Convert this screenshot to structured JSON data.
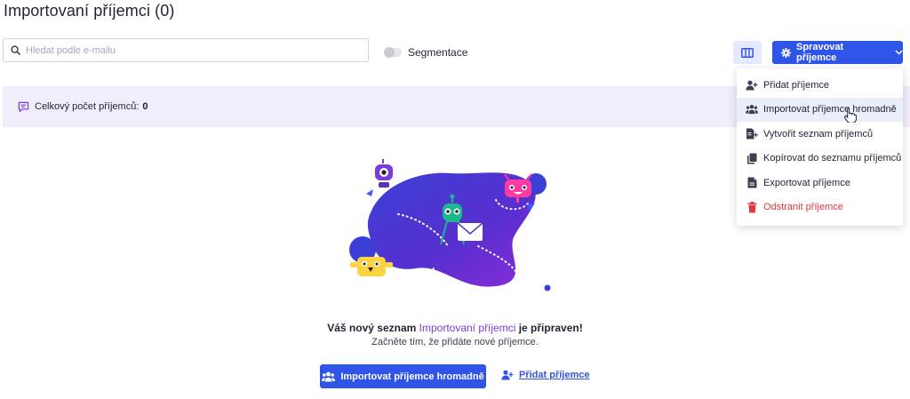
{
  "page": {
    "title": "Importovaní příjemci (0)"
  },
  "toolbar": {
    "search_placeholder": "Hledat podle e-mailu",
    "search_value": "",
    "search_icon": "search-icon",
    "segmentation_label": "Segmentace",
    "segmentation_on": false,
    "columns_icon": "columns-icon",
    "manage_label": "Spravovat příjemce",
    "manage_icon": "gear-icon",
    "manage_chevron": "chevron-down-icon"
  },
  "info": {
    "label": "Celkový počet příjemců:",
    "count": "0",
    "icon": "message-icon"
  },
  "dropdown": {
    "items": [
      {
        "label": "Přidat příjemce",
        "icon": "add-user-icon"
      },
      {
        "label": "Importovat příjemce hromadně",
        "icon": "users-icon",
        "hovered": true
      },
      {
        "label": "Vytvořit seznam příjemců",
        "icon": "create-list-icon"
      },
      {
        "label": "Kopírovat do seznamu příjemců",
        "icon": "copy-icon"
      },
      {
        "label": "Exportovat příjemce",
        "icon": "export-file-icon"
      },
      {
        "label": "Odstranit příjemce",
        "icon": "trash-icon",
        "danger": true
      }
    ]
  },
  "empty_state": {
    "title_prefix": "Váš nový seznam",
    "title_accent": "Importovaní příjemci",
    "title_suffix": "je připraven!",
    "subtitle": "Začněte tím, že přidáte nové příjemce.",
    "import_button": "Importovat příjemce hromadně",
    "add_link": "Přidat příjemce"
  },
  "colors": {
    "primary": "#2f54e8",
    "accent_purple": "#7a3cd6",
    "info_bg": "#f1edfb",
    "danger": "#e0383e"
  }
}
